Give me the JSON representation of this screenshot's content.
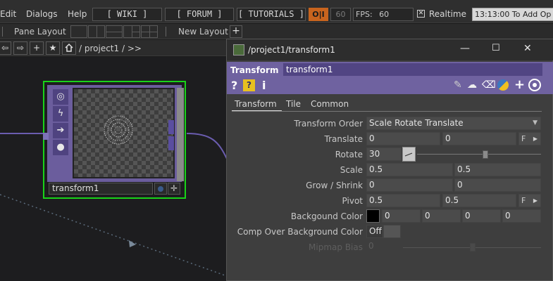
{
  "menu": {
    "items": [
      "Edit",
      "Dialogs",
      "Help"
    ]
  },
  "toolbar": {
    "wiki": "[ WIKI ]",
    "forum": "[ FORUM ]",
    "tutorials": "[ TUTORIALS ]",
    "perform_toggle": "O|I",
    "fps_target": "60",
    "fps_label": "FPS:",
    "fps_value": "60",
    "realtime_label": "Realtime",
    "realtime_checked": true,
    "timecode": "13:13:00 To Add Op"
  },
  "panebar": {
    "pane_layout_label": "Pane Layout",
    "new_layout_label": "New Layout",
    "add_label": "+"
  },
  "pathbar": {
    "path": "/ project1 / >>"
  },
  "node": {
    "name": "transform1"
  },
  "dialog": {
    "title": "/project1/transform1",
    "op_type": "Transform",
    "op_name": "transform1",
    "tabs": [
      "Transform",
      "Tile",
      "Common"
    ],
    "active_tab": "Transform",
    "params": {
      "transform_order": {
        "label": "Transform Order",
        "value": "Scale Rotate Translate"
      },
      "translate": {
        "label": "Translate",
        "x": "0",
        "y": "0",
        "unit": "F"
      },
      "rotate": {
        "label": "Rotate",
        "value": "30"
      },
      "scale": {
        "label": "Scale",
        "x": "0.5",
        "y": "0.5"
      },
      "grow_shrink": {
        "label": "Grow / Shrink",
        "x": "0",
        "y": "0"
      },
      "pivot": {
        "label": "Pivot",
        "x": "0.5",
        "y": "0.5",
        "unit": "F"
      },
      "bg_color": {
        "label": "Backgound Color",
        "r": "0",
        "g": "0",
        "b": "0",
        "a": "0"
      },
      "comp_over": {
        "label": "Comp Over Background Color",
        "value": "Off"
      },
      "mipmap": {
        "label": "Mipmap Bias",
        "value": "0"
      }
    }
  },
  "colors": {
    "accent": "#6f62a0",
    "node_select": "#19d319",
    "perform_toggle": "#c8641e"
  }
}
